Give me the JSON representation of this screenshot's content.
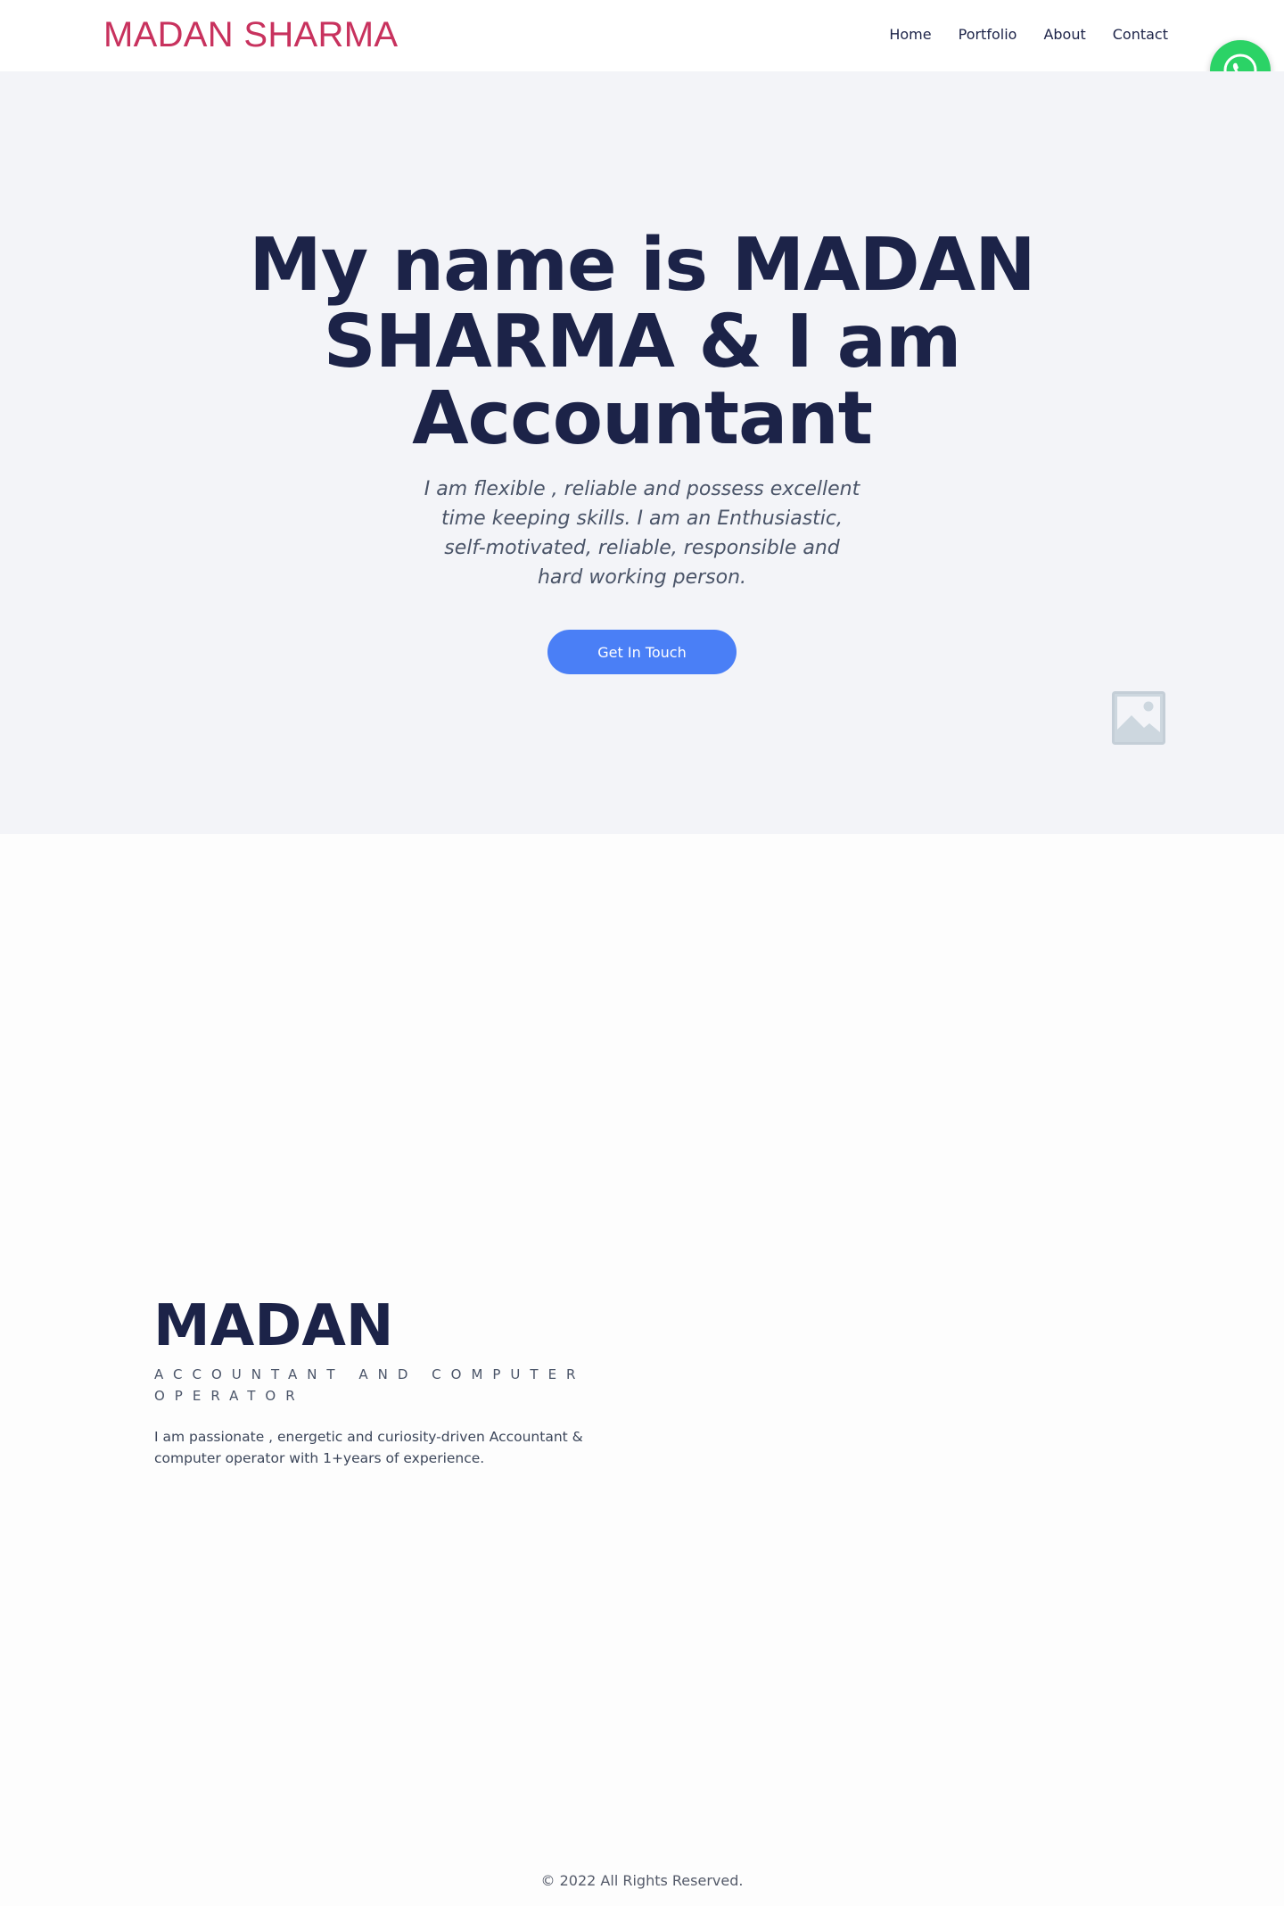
{
  "header": {
    "logo": "MADAN SHARMA",
    "nav": [
      "Home",
      "Portfolio",
      "About",
      "Contact"
    ]
  },
  "hero": {
    "title": "My name is MADAN SHARMA & I am Accountant",
    "subtitle": "I am flexible , reliable and possess excellent time keeping skills. I am an Enthusiastic, self-motivated, reliable, responsible and hard working person.",
    "cta_label": "Get In Touch"
  },
  "about": {
    "name": "MADAN",
    "role": "ACCOUNTANT AND COMPUTER OPERATOR",
    "description": "I am passionate , energetic and curiosity-driven Accountant & computer operator with 1+years of experience."
  },
  "footer": {
    "copyright": "© 2022 All Rights Reserved."
  },
  "icons": {
    "floating_button": "whatsapp-icon",
    "hero_image": "image-placeholder-icon"
  },
  "colors": {
    "logo": "#c8325e",
    "heading": "#1c2348",
    "hero_background": "#f3f4f8",
    "cta": "#4a7ff6",
    "whatsapp": "#2bd366"
  }
}
